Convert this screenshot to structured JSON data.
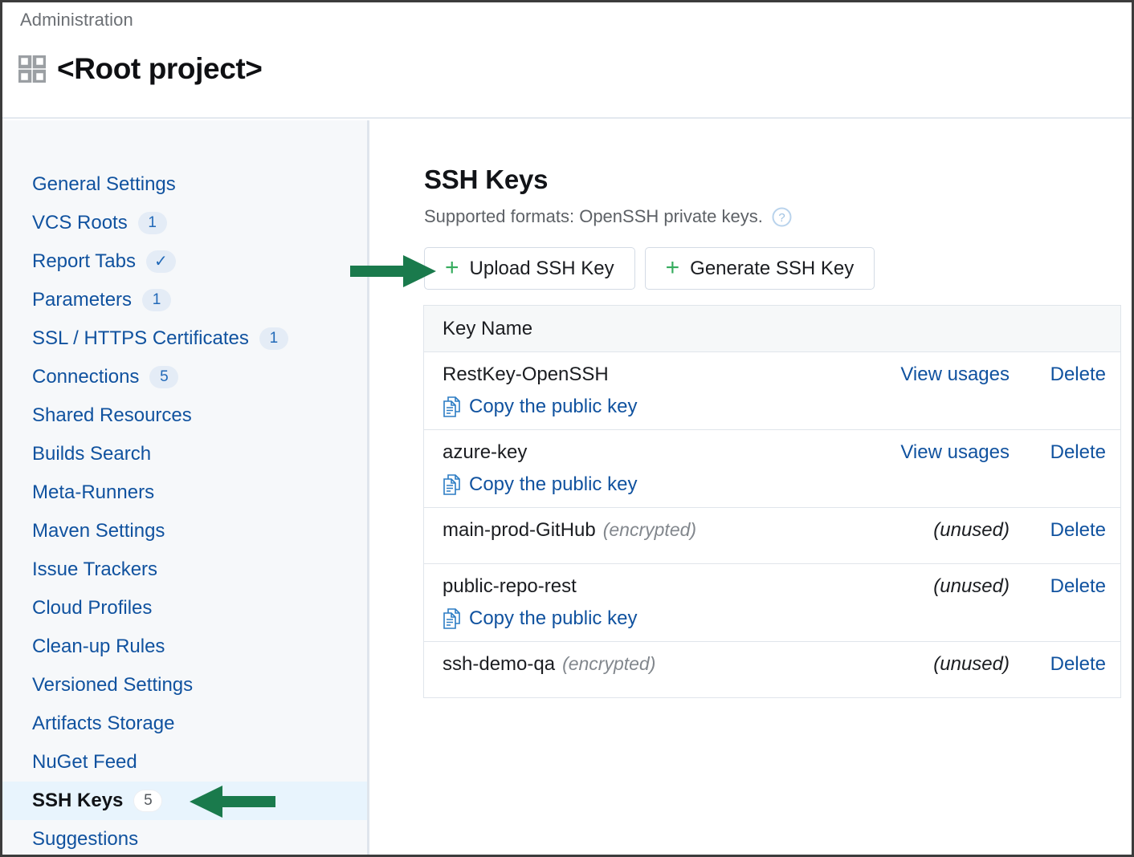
{
  "header": {
    "breadcrumb": "Administration",
    "title": "<Root project>",
    "grid_icon": "grid-icon"
  },
  "sidebar": {
    "items": [
      {
        "label": "General Settings",
        "badge": null,
        "active": false
      },
      {
        "label": "VCS Roots",
        "badge": "1",
        "active": false
      },
      {
        "label": "Report Tabs",
        "badge": "✓",
        "active": false
      },
      {
        "label": "Parameters",
        "badge": "1",
        "active": false
      },
      {
        "label": "SSL / HTTPS Certificates",
        "badge": "1",
        "active": false
      },
      {
        "label": "Connections",
        "badge": "5",
        "active": false
      },
      {
        "label": "Shared Resources",
        "badge": null,
        "active": false
      },
      {
        "label": "Builds Search",
        "badge": null,
        "active": false
      },
      {
        "label": "Meta-Runners",
        "badge": null,
        "active": false
      },
      {
        "label": "Maven Settings",
        "badge": null,
        "active": false
      },
      {
        "label": "Issue Trackers",
        "badge": null,
        "active": false
      },
      {
        "label": "Cloud Profiles",
        "badge": null,
        "active": false
      },
      {
        "label": "Clean-up Rules",
        "badge": null,
        "active": false
      },
      {
        "label": "Versioned Settings",
        "badge": null,
        "active": false
      },
      {
        "label": "Artifacts Storage",
        "badge": null,
        "active": false
      },
      {
        "label": "NuGet Feed",
        "badge": null,
        "active": false
      },
      {
        "label": "SSH Keys",
        "badge": "5",
        "active": true
      },
      {
        "label": "Suggestions",
        "badge": null,
        "active": false
      }
    ]
  },
  "main": {
    "title": "SSH Keys",
    "subtitle": "Supported formats: OpenSSH private keys.",
    "help_icon": "help-circle-icon",
    "upload_button": "Upload SSH Key",
    "generate_button": "Generate SSH Key",
    "table": {
      "column_header": "Key Name",
      "copy_label": "Copy the public key",
      "rows": [
        {
          "name": "RestKey-OpenSSH",
          "flag": "",
          "mid": "View usages",
          "mid_kind": "link",
          "delete": "Delete",
          "copy": true
        },
        {
          "name": "azure-key",
          "flag": "",
          "mid": "View usages",
          "mid_kind": "link",
          "delete": "Delete",
          "copy": true
        },
        {
          "name": "main-prod-GitHub",
          "flag": "(encrypted)",
          "mid": "(unused)",
          "mid_kind": "unused",
          "delete": "Delete",
          "copy": false
        },
        {
          "name": "public-repo-rest",
          "flag": "",
          "mid": "(unused)",
          "mid_kind": "unused",
          "delete": "Delete",
          "copy": true
        },
        {
          "name": "ssh-demo-qa",
          "flag": "(encrypted)",
          "mid": "(unused)",
          "mid_kind": "unused",
          "delete": "Delete",
          "copy": false
        }
      ]
    }
  },
  "annotations": {
    "arrow_color": "#1a7a4c",
    "arrows": [
      {
        "name": "arrow-pointing-to-upload-ssh-key",
        "direction": "right"
      },
      {
        "name": "arrow-pointing-to-ssh-keys-nav",
        "direction": "left"
      }
    ]
  },
  "colors": {
    "link_blue": "#10529f",
    "plus_green": "#36ac5e",
    "active_row_bg": "#e8f4fd",
    "sidebar_bg": "#f6f8fa",
    "badge_bg": "#e4ecf6"
  }
}
